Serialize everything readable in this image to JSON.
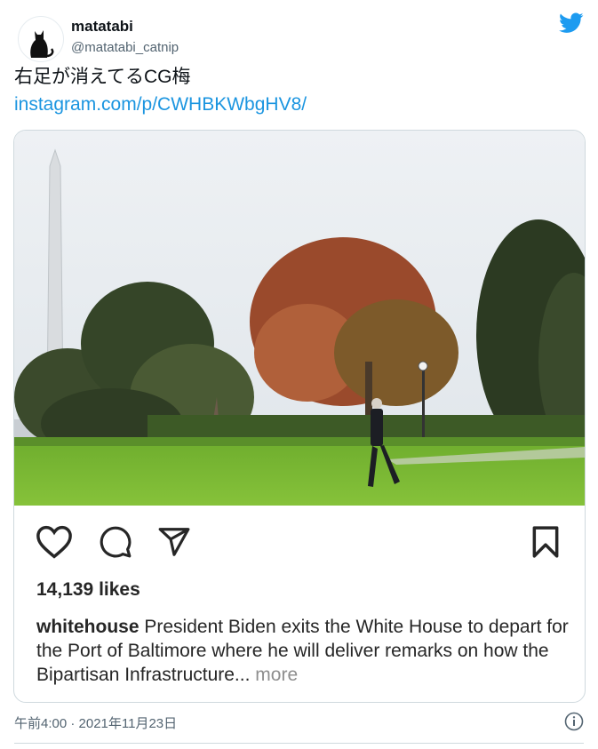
{
  "tweet": {
    "author_name": "matatabi",
    "author_handle": "@matatabi_catnip",
    "text": "右足が消えてるCG梅",
    "link_text": "instagram.com/p/CWHBKWbgHV8/",
    "timestamp": "午前4:00 · 2021年11月23日"
  },
  "instagram": {
    "likes": "14,139 likes",
    "caption_user": "whitehouse",
    "caption_text": "President Biden exits the White House to depart for the Port of Baltimore where he will deliver remarks on how the Bipartisan Infrastructure...",
    "more_label": "more"
  },
  "colors": {
    "twitter_blue": "#1d9bf0",
    "link_blue": "#1b95e0",
    "secondary_text": "#536471"
  },
  "icons": [
    "twitter-bird-icon",
    "heart-icon",
    "comment-icon",
    "share-icon",
    "bookmark-icon",
    "info-icon"
  ]
}
